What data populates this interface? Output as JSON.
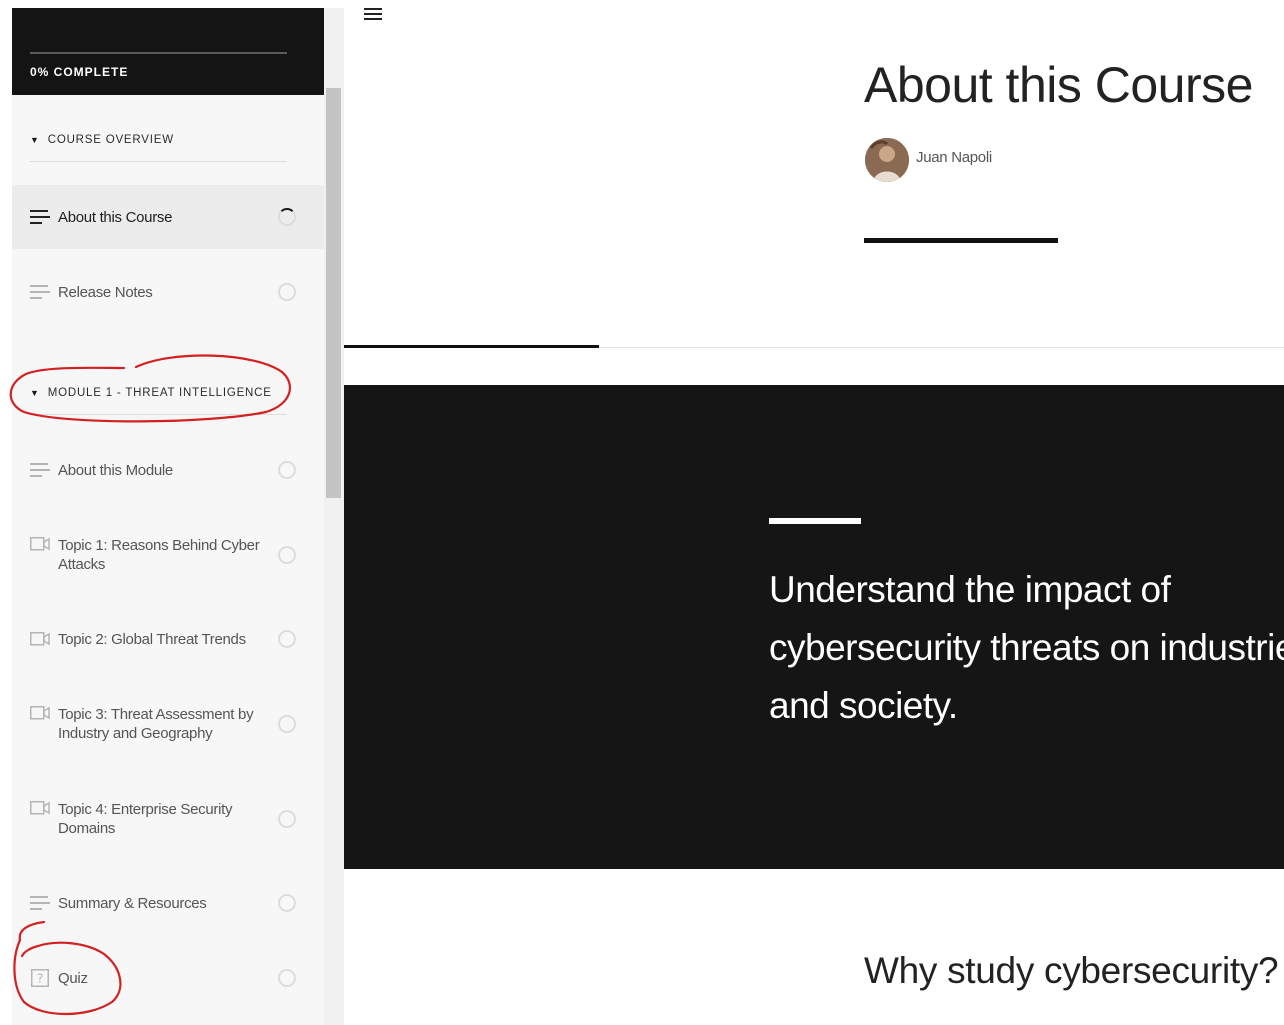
{
  "sidebar": {
    "progress_label": "0% COMPLETE",
    "progress_percent": 0,
    "sections": [
      {
        "label": "COURSE OVERVIEW"
      },
      {
        "label": "MODULE 1 - THREAT INTELLIGENCE"
      }
    ],
    "lessons": [
      {
        "label": "About this Course",
        "icon": "text-lines-icon",
        "active": true
      },
      {
        "label": "Release Notes",
        "icon": "text-lines-icon"
      },
      {
        "label": "About this Module",
        "icon": "text-lines-icon"
      },
      {
        "label": "Topic 1: Reasons Behind Cyber Attacks",
        "icon": "video-icon"
      },
      {
        "label": "Topic 2: Global Threat Trends",
        "icon": "video-icon"
      },
      {
        "label": "Topic 3: Threat Assessment by Industry and Geography",
        "icon": "video-icon"
      },
      {
        "label": "Topic 4: Enterprise Security Domains",
        "icon": "video-icon"
      },
      {
        "label": "Summary & Resources",
        "icon": "text-lines-icon"
      },
      {
        "label": "Quiz",
        "icon": "quiz-icon"
      }
    ]
  },
  "main": {
    "title": "About this Course",
    "author": "Juan Napoli",
    "hero_text": "Understand the impact of cybersecurity threats on industries and society.",
    "section_heading": "Why study cybersecurity?"
  },
  "colors": {
    "header_bg": "#141414",
    "hero_bg": "#151515",
    "annotation": "#d32020"
  }
}
